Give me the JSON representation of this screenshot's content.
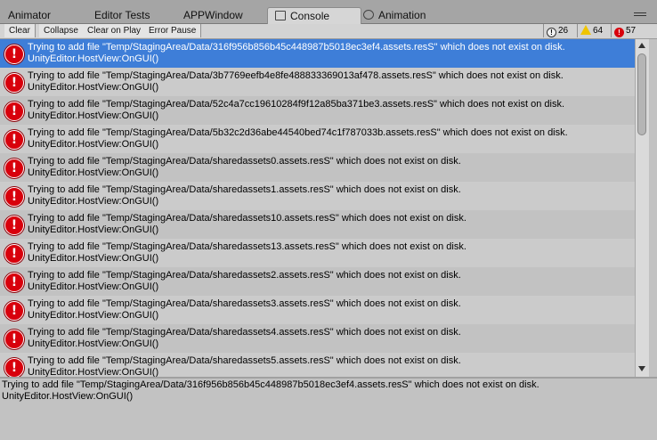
{
  "tabs": [
    {
      "label": "Animator"
    },
    {
      "label": "Editor Tests"
    },
    {
      "label": "APPWindow"
    },
    {
      "label": "Console"
    },
    {
      "label": "Animation"
    }
  ],
  "toolbar": {
    "clear": "Clear",
    "collapse": "Collapse",
    "clear_on_play": "Clear on Play",
    "error_pause": "Error Pause",
    "info_count": "26",
    "warning_count": "64",
    "error_count": "57"
  },
  "log_entries": [
    {
      "line1": "Trying to add file \"Temp/StagingArea/Data/316f956b856b45c448987b5018ec3ef4.assets.resS\" which does not exist on disk.",
      "line2": "UnityEditor.HostView:OnGUI()"
    },
    {
      "line1": "Trying to add file \"Temp/StagingArea/Data/3b7769eefb4e8fe488833369013af478.assets.resS\" which does not exist on disk.",
      "line2": "UnityEditor.HostView:OnGUI()"
    },
    {
      "line1": "Trying to add file \"Temp/StagingArea/Data/52c4a7cc19610284f9f12a85ba371be3.assets.resS\" which does not exist on disk.",
      "line2": "UnityEditor.HostView:OnGUI()"
    },
    {
      "line1": "Trying to add file \"Temp/StagingArea/Data/5b32c2d36abe44540bed74c1f787033b.assets.resS\" which does not exist on disk.",
      "line2": "UnityEditor.HostView:OnGUI()"
    },
    {
      "line1": "Trying to add file \"Temp/StagingArea/Data/sharedassets0.assets.resS\" which does not exist on disk.",
      "line2": "UnityEditor.HostView:OnGUI()"
    },
    {
      "line1": "Trying to add file \"Temp/StagingArea/Data/sharedassets1.assets.resS\" which does not exist on disk.",
      "line2": "UnityEditor.HostView:OnGUI()"
    },
    {
      "line1": "Trying to add file \"Temp/StagingArea/Data/sharedassets10.assets.resS\" which does not exist on disk.",
      "line2": "UnityEditor.HostView:OnGUI()"
    },
    {
      "line1": "Trying to add file \"Temp/StagingArea/Data/sharedassets13.assets.resS\" which does not exist on disk.",
      "line2": "UnityEditor.HostView:OnGUI()"
    },
    {
      "line1": "Trying to add file \"Temp/StagingArea/Data/sharedassets2.assets.resS\" which does not exist on disk.",
      "line2": "UnityEditor.HostView:OnGUI()"
    },
    {
      "line1": "Trying to add file \"Temp/StagingArea/Data/sharedassets3.assets.resS\" which does not exist on disk.",
      "line2": "UnityEditor.HostView:OnGUI()"
    },
    {
      "line1": "Trying to add file \"Temp/StagingArea/Data/sharedassets4.assets.resS\" which does not exist on disk.",
      "line2": "UnityEditor.HostView:OnGUI()"
    },
    {
      "line1": "Trying to add file \"Temp/StagingArea/Data/sharedassets5.assets.resS\" which does not exist on disk.",
      "line2": "UnityEditor.HostView:OnGUI()"
    }
  ],
  "detail": {
    "line1": "Trying to add file \"Temp/StagingArea/Data/316f956b856b45c448987b5018ec3ef4.assets.resS\" which does not exist on disk.",
    "line2": "UnityEditor.HostView:OnGUI()"
  },
  "icons": {
    "error": "!",
    "info": "!"
  },
  "colors": {
    "selection": "#3e7ed8",
    "error": "#d8000c",
    "warning": "#f0c400"
  }
}
